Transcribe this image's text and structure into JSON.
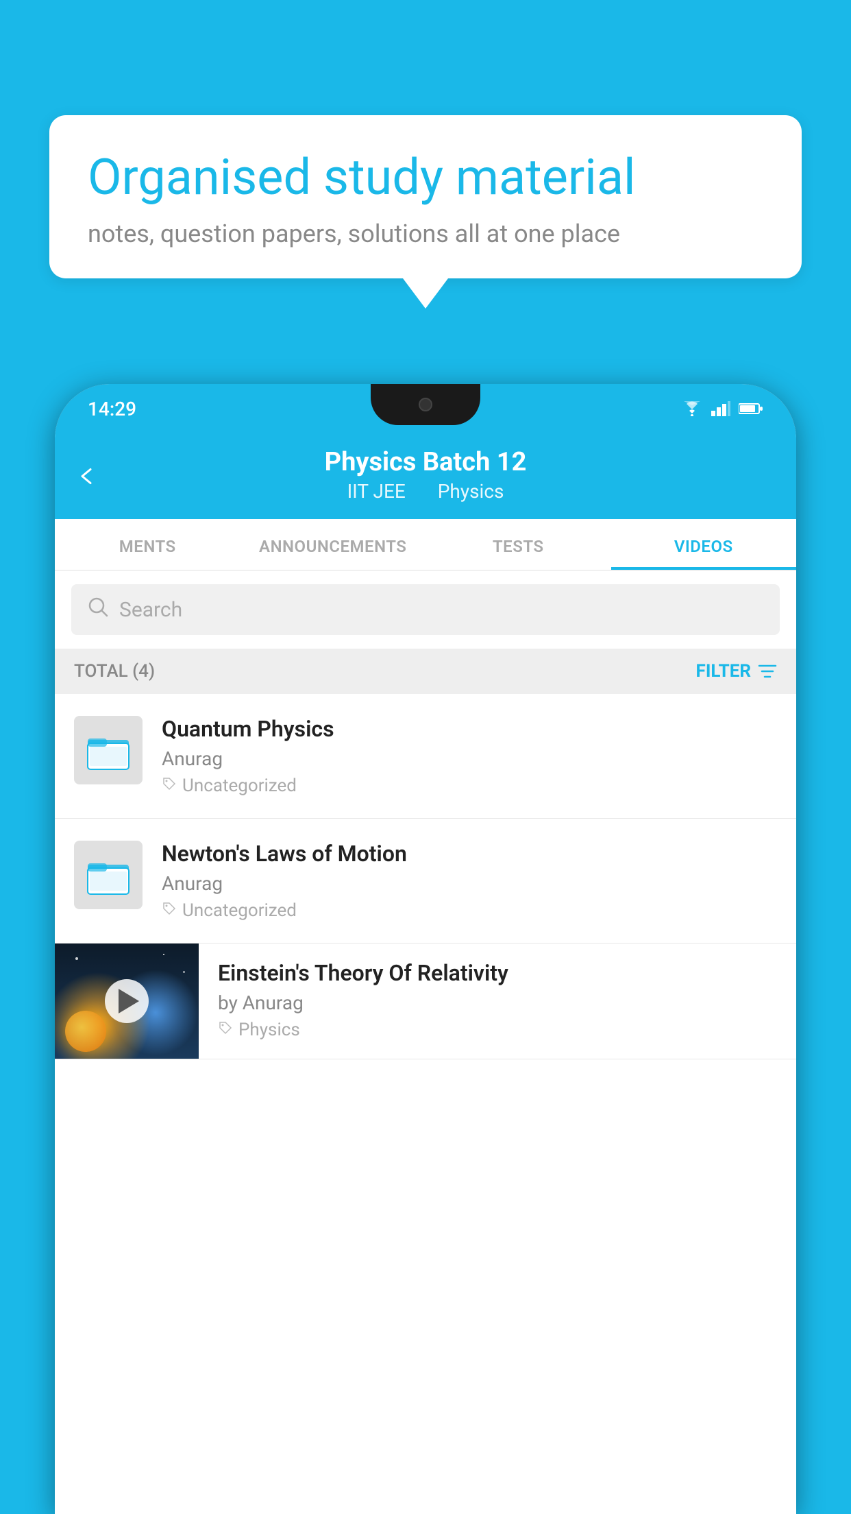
{
  "background": {
    "color": "#1ab8e8"
  },
  "bubble": {
    "title": "Organised study material",
    "subtitle": "notes, question papers, solutions all at one place"
  },
  "phone": {
    "status_bar": {
      "time": "14:29"
    },
    "header": {
      "title": "Physics Batch 12",
      "subtitle_part1": "IIT JEE",
      "subtitle_part2": "Physics"
    },
    "tabs": [
      {
        "label": "MENTS",
        "active": false
      },
      {
        "label": "ANNOUNCEMENTS",
        "active": false
      },
      {
        "label": "TESTS",
        "active": false
      },
      {
        "label": "VIDEOS",
        "active": true
      }
    ],
    "search": {
      "placeholder": "Search"
    },
    "filter": {
      "total_label": "TOTAL (4)",
      "button_label": "FILTER"
    },
    "videos": [
      {
        "id": "quantum",
        "title": "Quantum Physics",
        "author": "Anurag",
        "tag": "Uncategorized",
        "has_thumbnail": false
      },
      {
        "id": "newton",
        "title": "Newton's Laws of Motion",
        "author": "Anurag",
        "tag": "Uncategorized",
        "has_thumbnail": false
      },
      {
        "id": "einstein",
        "title": "Einstein's Theory Of Relativity",
        "author": "by Anurag",
        "tag": "Physics",
        "has_thumbnail": true
      }
    ]
  }
}
